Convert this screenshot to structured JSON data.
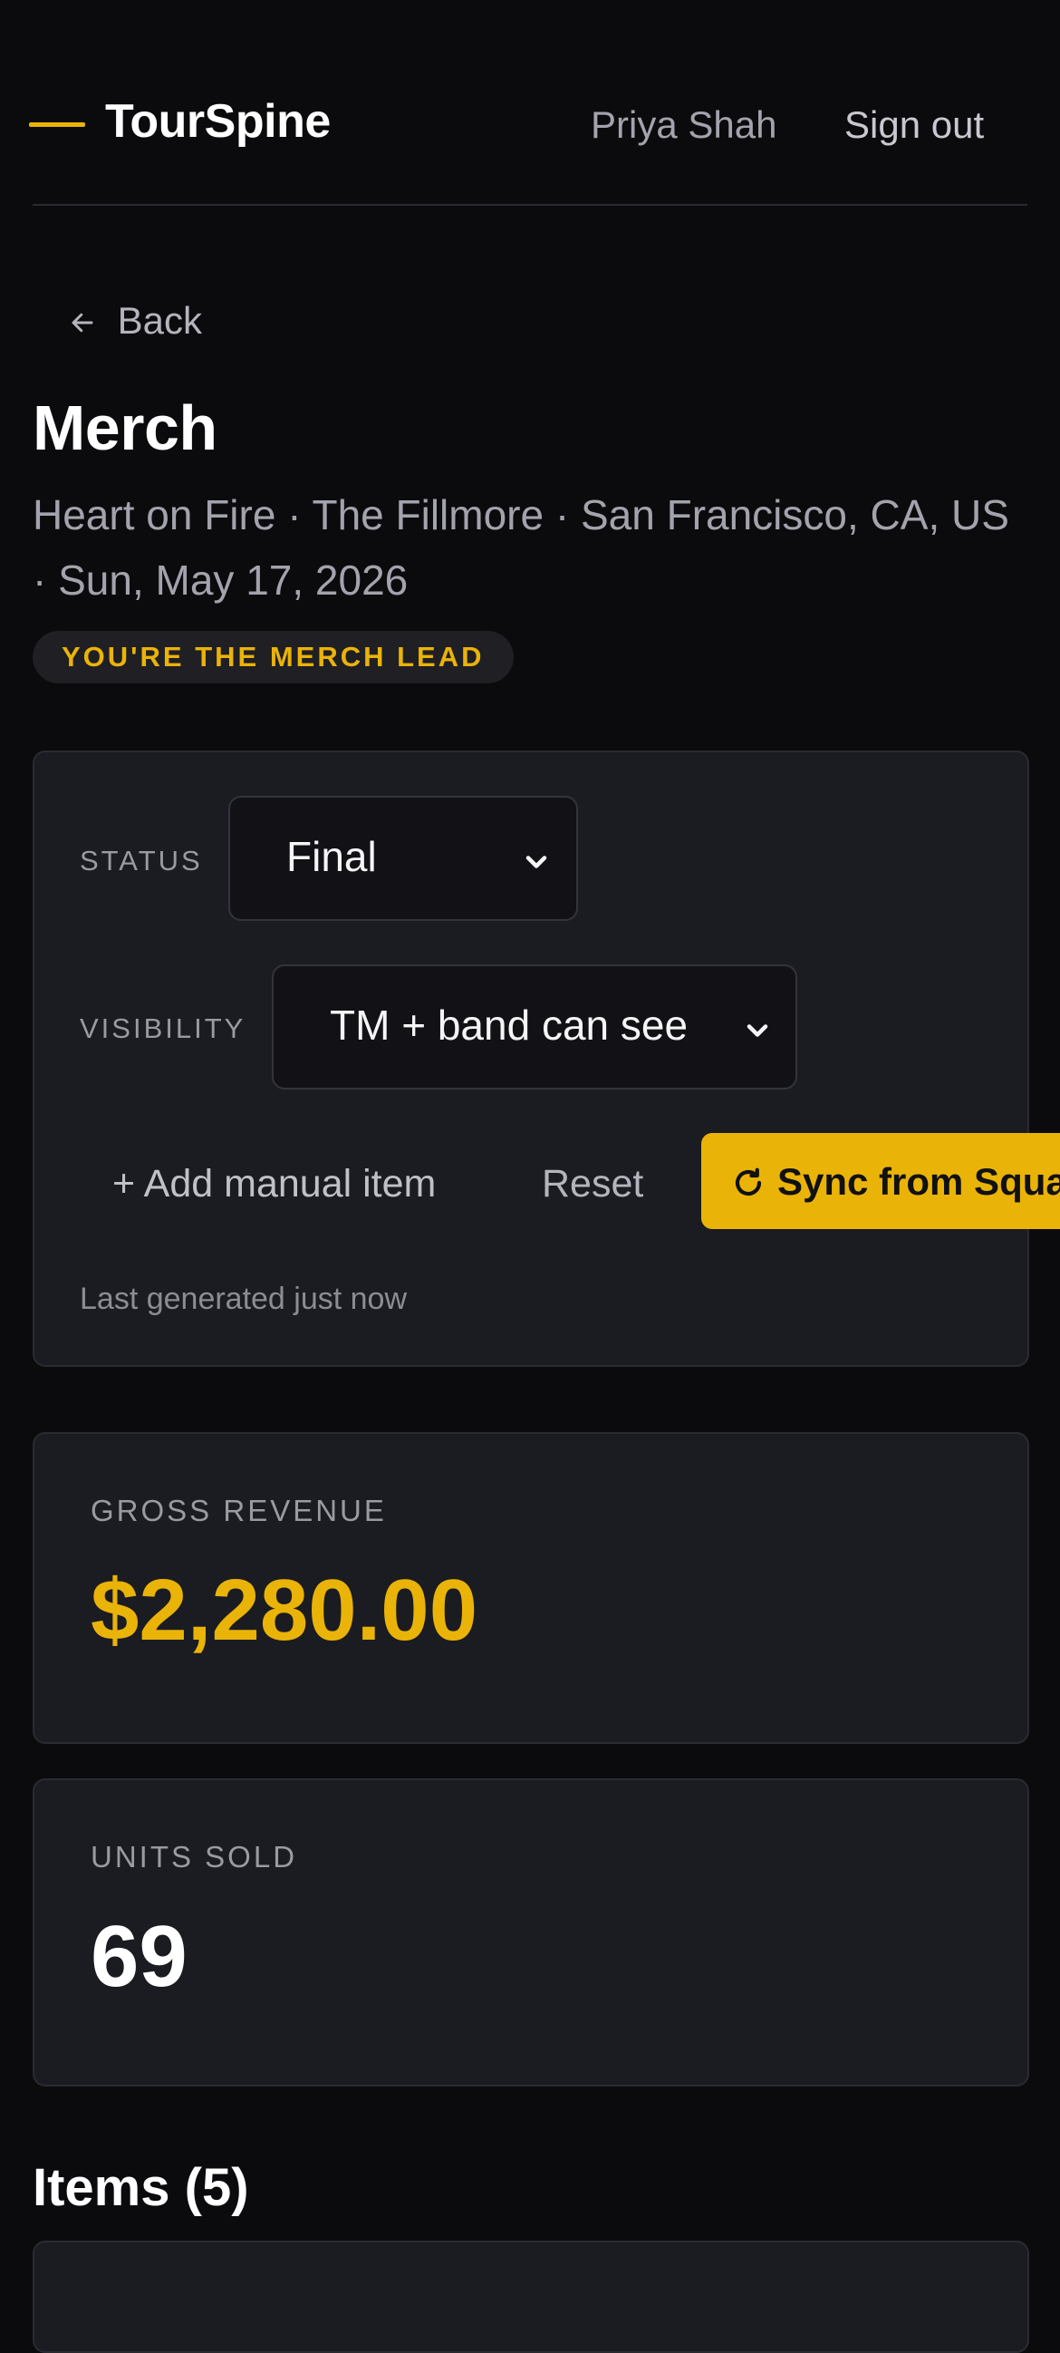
{
  "header": {
    "app_name": "TourSpine",
    "user_name": "Priya Shah",
    "sign_out_label": "Sign out"
  },
  "nav": {
    "back_label": "Back",
    "back_icon": "arrow-left-icon"
  },
  "page": {
    "title": "Merch",
    "subtitle": "Heart on Fire · The Fillmore · San Francisco, CA, US · Sun, May 17, 2026",
    "role_badge": "YOU'RE THE MERCH LEAD"
  },
  "controls": {
    "status_label": "STATUS",
    "status_value": "Final",
    "visibility_label": "VISIBILITY",
    "visibility_value": "TM + band can see",
    "add_manual_item_label": "+ Add manual item",
    "reset_label": "Reset",
    "sync_label": "Sync from Square",
    "sync_icon": "refresh-icon",
    "last_generated": "Last generated just now"
  },
  "stats": {
    "gross_revenue_label": "GROSS REVENUE",
    "gross_revenue_value": "$2,280.00",
    "units_sold_label": "UNITS SOLD",
    "units_sold_value": "69"
  },
  "items": {
    "heading": "Items (5)"
  },
  "colors": {
    "accent": "#eab308",
    "background": "#0b0b0e",
    "card": "#1b1c21"
  }
}
